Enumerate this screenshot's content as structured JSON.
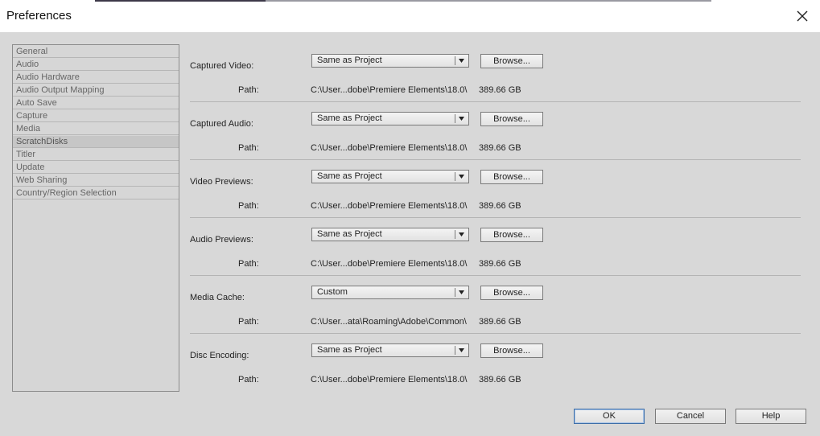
{
  "window": {
    "title": "Preferences"
  },
  "sidebar": {
    "items": [
      {
        "label": "General"
      },
      {
        "label": "Audio"
      },
      {
        "label": "Audio Hardware"
      },
      {
        "label": "Audio Output Mapping"
      },
      {
        "label": "Auto Save"
      },
      {
        "label": "Capture"
      },
      {
        "label": "Media"
      },
      {
        "label": "ScratchDisks",
        "selected": true
      },
      {
        "label": "Titler"
      },
      {
        "label": "Update"
      },
      {
        "label": "Web Sharing"
      },
      {
        "label": "Country/Region Selection"
      }
    ]
  },
  "scratch_disks": {
    "path_label": "Path:",
    "browse_label": "Browse...",
    "rows": [
      {
        "label": "Captured Video:",
        "location": "Same as Project",
        "path": "C:\\User...dobe\\Premiere Elements\\18.0\\",
        "size": "389.66 GB"
      },
      {
        "label": "Captured Audio:",
        "location": "Same as Project",
        "path": "C:\\User...dobe\\Premiere Elements\\18.0\\",
        "size": "389.66 GB"
      },
      {
        "label": "Video Previews:",
        "location": "Same as Project",
        "path": "C:\\User...dobe\\Premiere Elements\\18.0\\",
        "size": "389.66 GB"
      },
      {
        "label": "Audio Previews:",
        "location": "Same as Project",
        "path": "C:\\User...dobe\\Premiere Elements\\18.0\\",
        "size": "389.66 GB"
      },
      {
        "label": "Media Cache:",
        "location": "Custom",
        "path": "C:\\User...ata\\Roaming\\Adobe\\Common\\",
        "size": "389.66 GB"
      },
      {
        "label": "Disc Encoding:",
        "location": "Same as Project",
        "path": "C:\\User...dobe\\Premiere Elements\\18.0\\",
        "size": "389.66 GB"
      }
    ]
  },
  "footer": {
    "ok_label": "OK",
    "cancel_label": "Cancel",
    "help_label": "Help"
  },
  "icons": {
    "close": "close-icon",
    "dropdown": "chevron-down-icon"
  }
}
